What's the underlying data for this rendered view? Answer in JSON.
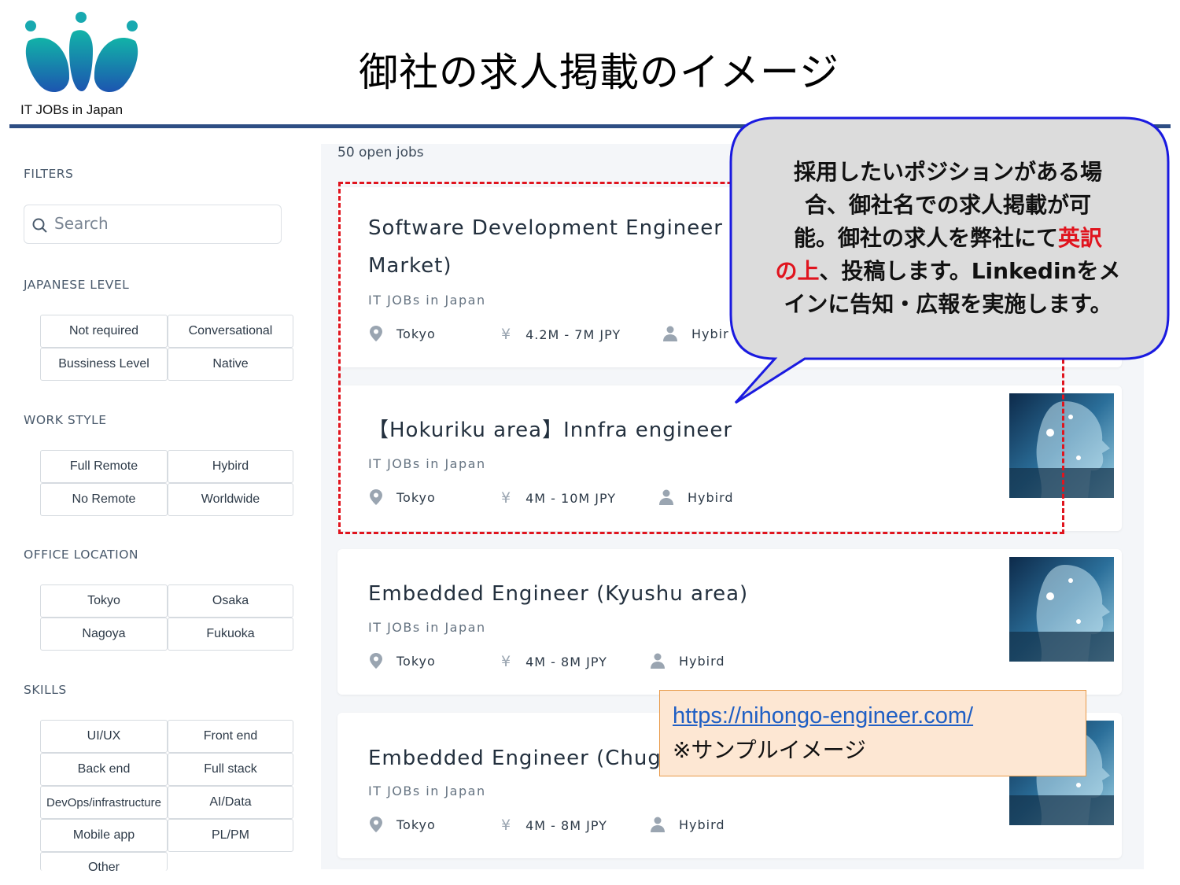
{
  "header": {
    "logo_caption": "IT JOBs in Japan",
    "title": "御社の求人掲載のイメージ"
  },
  "filters": {
    "heading": "FILTERS",
    "search_placeholder": "Search",
    "sections": [
      {
        "heading": "JAPANESE LEVEL",
        "options": [
          "Not required",
          "Conversational",
          "Bussiness Level",
          "Native"
        ]
      },
      {
        "heading": "WORK STYLE",
        "options": [
          "Full Remote",
          "Hybird",
          "No Remote",
          "Worldwide"
        ]
      },
      {
        "heading": "OFFICE LOCATION",
        "options": [
          "Tokyo",
          "Osaka",
          "Nagoya",
          "Fukuoka"
        ]
      },
      {
        "heading": "SKILLS",
        "options": [
          "UI/UX",
          "Front end",
          "Back end",
          "Full stack",
          "DevOps/infrastructure",
          "AI/Data",
          "Mobile app",
          "PL/PM",
          "Other"
        ]
      }
    ]
  },
  "jobs": {
    "count_label": "50 open jobs",
    "items": [
      {
        "title_line1": "Software Development Engineer",
        "title_line2": "Market)",
        "company": "IT JOBs in Japan",
        "location": "Tokyo",
        "salary": "4.2M - 7M JPY",
        "style": "Hybir"
      },
      {
        "title": "【Hokuriku area】Innfra engineer",
        "company": "IT JOBs in Japan",
        "location": "Tokyo",
        "salary": "4M - 10M JPY",
        "style": "Hybird"
      },
      {
        "title": "Embedded Engineer (Kyushu area)",
        "company": "IT JOBs in Japan",
        "location": "Tokyo",
        "salary": "4M - 8M JPY",
        "style": "Hybird"
      },
      {
        "title": "Embedded Engineer (Chug",
        "company": "IT JOBs in Japan",
        "location": "Tokyo",
        "salary": "4M - 8M JPY",
        "style": "Hybird"
      }
    ]
  },
  "callout": {
    "line1": "採用したいポジションがある場",
    "line2": "合、御社名での求人掲載が可",
    "line3_pre": "能。御社の求人を弊社にて",
    "line3_red": "英訳",
    "line4_red": "の上",
    "line4_post": "、投稿します。Linkedinをメ",
    "line5": "インに告知・広報を実施します。"
  },
  "note": {
    "link": "https://nihongo-engineer.com/",
    "text": "※サンプルイメージ"
  },
  "colors": {
    "header_rule": "#2e4e84",
    "dashed_frame": "#e0141e",
    "callout_border": "#1a1ae0",
    "callout_fill": "#dcdcdc",
    "note_fill": "#fde7d3",
    "logo_gradient_start": "#12a3a6",
    "logo_gradient_end": "#1c5bb0"
  },
  "icons": [
    "location-pin-icon",
    "yen-icon",
    "person-icon",
    "search-icon"
  ]
}
